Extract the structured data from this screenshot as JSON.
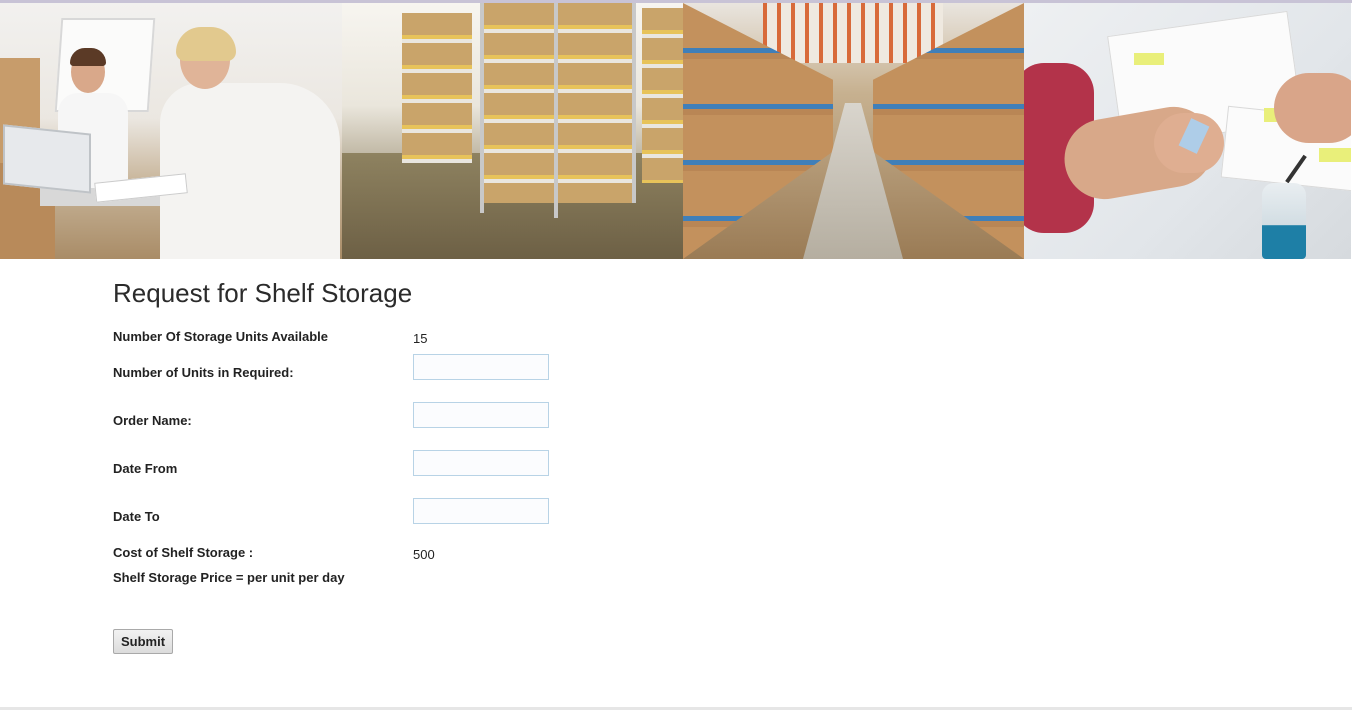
{
  "banner": {
    "images": [
      "office-team-image",
      "warehouse-shelves-image",
      "warehouse-aisle-image",
      "desk-planning-image"
    ]
  },
  "form": {
    "title": "Request for Shelf Storage",
    "units_available_label": "Number Of Storage Units Available",
    "units_available_value": "15",
    "units_required_label": "Number of Units in Required:",
    "units_required_value": "",
    "order_name_label": "Order Name:",
    "order_name_value": "",
    "date_from_label": "Date From",
    "date_from_value": "",
    "date_to_label": "Date To",
    "date_to_value": "",
    "cost_label": "Cost of Shelf Storage :",
    "cost_value": "500",
    "price_note": "Shelf Storage Price = per unit per day",
    "submit_label": "Submit"
  },
  "colors": {
    "input_border": "#b8d3e6",
    "button_border": "#a9a9a9",
    "text": "#222222"
  }
}
